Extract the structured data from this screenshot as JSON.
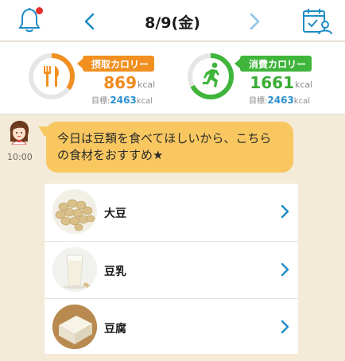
{
  "header": {
    "date": "8/9(金)",
    "has_notification": true
  },
  "calories": {
    "intake": {
      "label": "摂取カロリー",
      "value": "869",
      "unit": "kcal",
      "target_label": "目標:",
      "target_value": "2463",
      "target_unit": "kcal",
      "progress": 0.35,
      "color": "#f19021"
    },
    "burned": {
      "label": "消費カロリー",
      "value": "1661",
      "unit": "kcal",
      "target_label": "目標:",
      "target_value": "2463",
      "target_unit": "kcal",
      "progress": 0.67,
      "color": "#3fb53b"
    }
  },
  "chat": {
    "time": "10:00",
    "message": "今日は豆類を食べてほしいから、こちらの食材をおすすめ★"
  },
  "foods": [
    {
      "name": "大豆",
      "icon": "soybeans-image"
    },
    {
      "name": "豆乳",
      "icon": "soy-milk-image"
    },
    {
      "name": "豆腐",
      "icon": "tofu-image"
    }
  ],
  "colors": {
    "accent_blue": "#1f8cc8",
    "bubble": "#f8c760",
    "background": "#f3ead7"
  }
}
